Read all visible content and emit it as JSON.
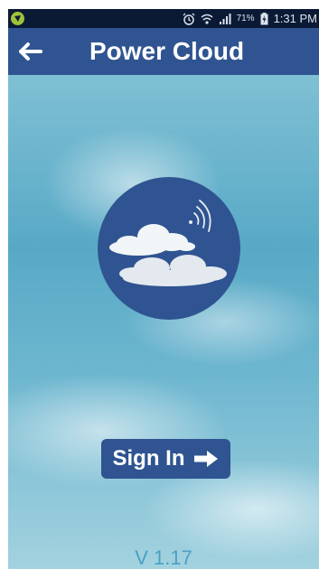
{
  "status_bar": {
    "battery_percent": "71%",
    "time": "1:31 PM",
    "icons": [
      "app-notification-icon",
      "alarm-icon",
      "wifi-icon",
      "signal-icon",
      "battery-icon"
    ]
  },
  "app_bar": {
    "title": "Power Cloud",
    "back_icon": "arrow-left-icon",
    "color": "#2f5491"
  },
  "main": {
    "logo_icon": "cloud-wifi-logo",
    "signin_label": "Sign In",
    "signin_icon": "arrow-right-icon",
    "version": "V 1.17"
  },
  "colors": {
    "status_bar": "#0b1a34",
    "accent": "#2f5491",
    "version_text": "#4ba0c5"
  }
}
